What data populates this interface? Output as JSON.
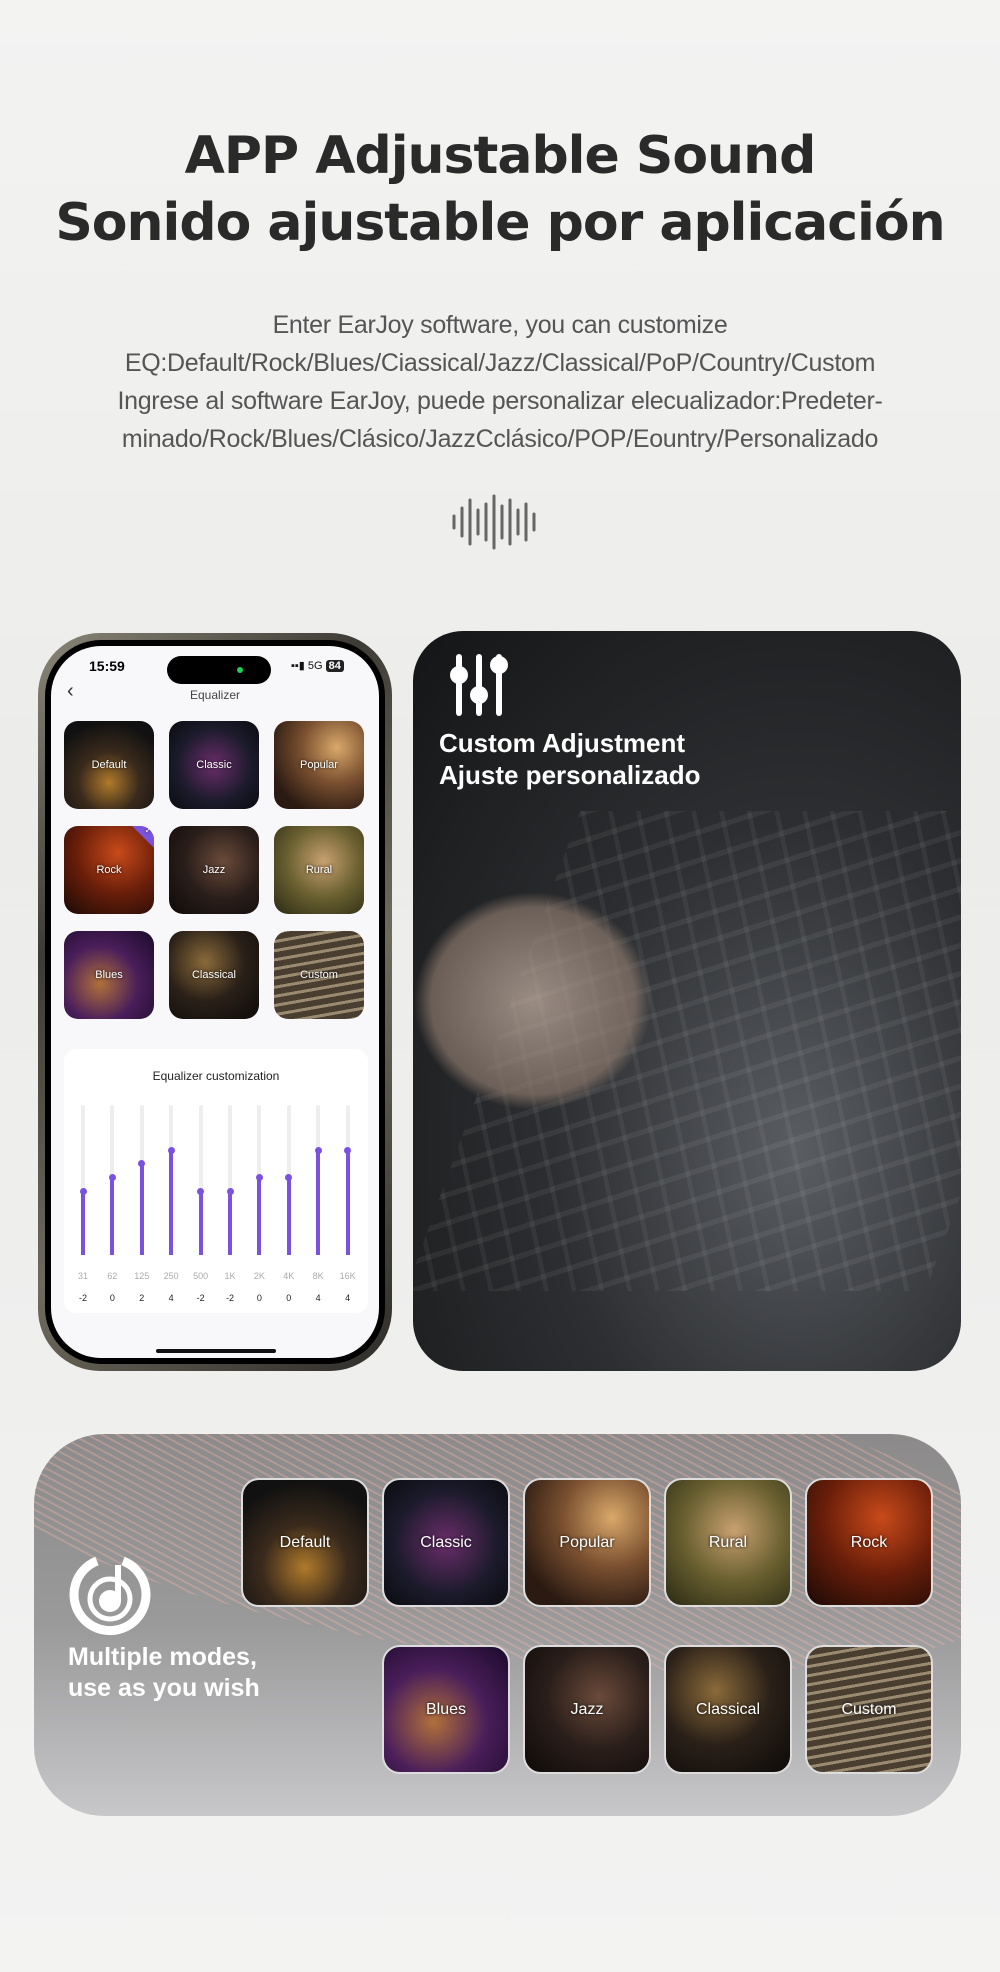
{
  "header": {
    "title_en": "APP Adjustable Sound",
    "title_es": "Sonido ajustable por aplicación",
    "desc": [
      "Enter EarJoy software, you can customize",
      "EQ:Default/Rock/Blues/Ciassical/Jazz/Classical/PoP/Country/Custom",
      "Ingrese al software EarJoy, puede personalizar elecualizador:Predeter-",
      "minado/Rock/Blues/Clásico/JazzCclásico/POP/Eountry/Personalizado"
    ],
    "icon": "sound-wave-icon"
  },
  "phone": {
    "time": "15:59",
    "network": "5G",
    "battery": "84",
    "screen_title": "Equalizer",
    "modes": [
      {
        "label": "Default"
      },
      {
        "label": "Classic"
      },
      {
        "label": "Popular"
      },
      {
        "label": "Rock",
        "selected": true
      },
      {
        "label": "Jazz"
      },
      {
        "label": "Rural"
      },
      {
        "label": "Blues"
      },
      {
        "label": "Classical"
      },
      {
        "label": "Custom"
      }
    ],
    "eq": {
      "title": "Equalizer customization",
      "accent": "#7b52e0",
      "bands": [
        {
          "freq": "31",
          "value": "-2"
        },
        {
          "freq": "62",
          "value": "0"
        },
        {
          "freq": "125",
          "value": "2"
        },
        {
          "freq": "250",
          "value": "4"
        },
        {
          "freq": "500",
          "value": "-2"
        },
        {
          "freq": "1K",
          "value": "-2"
        },
        {
          "freq": "2K",
          "value": "0"
        },
        {
          "freq": "4K",
          "value": "0"
        },
        {
          "freq": "8K",
          "value": "4"
        },
        {
          "freq": "16K",
          "value": "4"
        }
      ]
    }
  },
  "custom_card": {
    "icon": "sliders-icon",
    "line1": "Custom Adjustment",
    "line2": "Ajuste personalizado"
  },
  "modes_card": {
    "icon": "music-note-circle-icon",
    "line1": "Multiple modes,",
    "line2": "use as you wish",
    "row1": [
      "Default",
      "Classic",
      "Popular",
      "Rural",
      "Rock"
    ],
    "row2": [
      "Blues",
      "Jazz",
      "Classical",
      "Custom"
    ]
  }
}
